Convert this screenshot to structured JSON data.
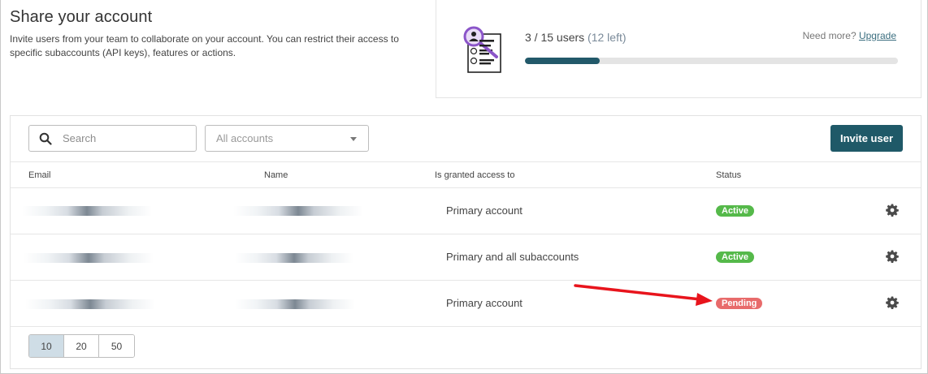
{
  "header": {
    "title": "Share your account",
    "description": "Invite users from your team to collaborate on your account. You can restrict their access to specific subaccounts (API keys), features or actions."
  },
  "usage": {
    "count_text": "3 / 15 users",
    "left_text": "(12 left)",
    "need_more": "Need more?",
    "upgrade_link": "Upgrade",
    "progress_fraction": 0.2,
    "icon": "user-list-magnifier-icon"
  },
  "toolbar": {
    "search_placeholder": "Search",
    "accounts_select_value": "All accounts",
    "invite_button": "Invite user"
  },
  "table": {
    "columns": [
      "Email",
      "Name",
      "Is granted access to",
      "Status"
    ],
    "rows": [
      {
        "access": "Primary account",
        "status": "Active",
        "status_color": "#55b94a"
      },
      {
        "access": "Primary and all subaccounts",
        "status": "Active",
        "status_color": "#55b94a"
      },
      {
        "access": "Primary account",
        "status": "Pending",
        "status_color": "#e86b6b"
      }
    ]
  },
  "pagination": {
    "options": [
      "10",
      "20",
      "50"
    ],
    "selected": "10"
  },
  "colors": {
    "primary": "#1f5968",
    "active": "#55b94a",
    "pending": "#e86b6b",
    "annotation_arrow": "#e8141c"
  }
}
